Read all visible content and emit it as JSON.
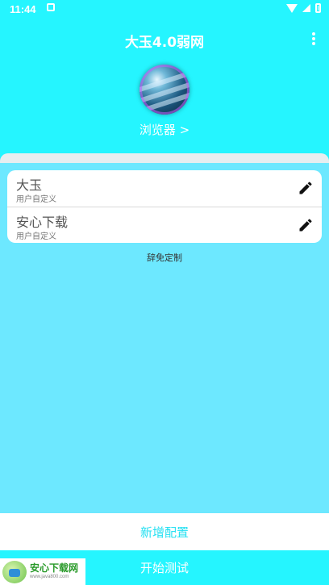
{
  "status": {
    "time": "11:44"
  },
  "app": {
    "title": "大玉4.0弱网",
    "browser_link": "浏览器 >"
  },
  "configs": [
    {
      "name": "大玉",
      "sub": "用户自定义"
    },
    {
      "name": "安心下载",
      "sub": "用户自定义"
    }
  ],
  "disclaimer": "辞免定制",
  "buttons": {
    "new_config": "新增配置",
    "start_test": "开始测试"
  },
  "watermark": {
    "name": "安心下载网",
    "url": "www.java800.com"
  },
  "colors": {
    "accent": "#25f5ff",
    "panel": "#6de8ff",
    "accent_text": "#25e0f2"
  }
}
